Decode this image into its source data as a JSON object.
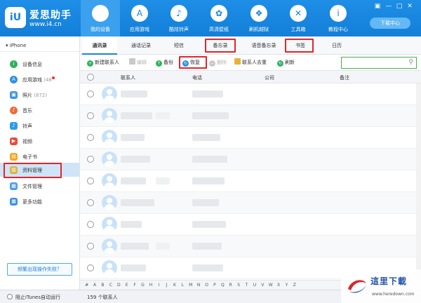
{
  "app": {
    "logo_badge": "iU",
    "name": "爱思助手",
    "url": "www.i4.cn"
  },
  "nav": [
    {
      "label": "我的设备",
      "icon": "apple-icon",
      "glyph": ""
    },
    {
      "label": "应用游戏",
      "icon": "app-store-icon",
      "glyph": "A"
    },
    {
      "label": "酷炫铃声",
      "icon": "bell-icon",
      "glyph": "♪"
    },
    {
      "label": "高清壁纸",
      "icon": "flower-icon",
      "glyph": "✿"
    },
    {
      "label": "刷机越狱",
      "icon": "dropbox-icon",
      "glyph": "❖"
    },
    {
      "label": "工具箱",
      "icon": "tools-icon",
      "glyph": "✕"
    },
    {
      "label": "教程中心",
      "icon": "info-icon",
      "glyph": "i"
    }
  ],
  "window": {
    "download_label": "下载中心",
    "icon_glyph": "▣",
    "min_glyph": "—",
    "max_glyph": "□",
    "close_glyph": "✕"
  },
  "sidebar": {
    "device": "iPhone",
    "device_arrow": "▾",
    "items": [
      {
        "label": "设备信息",
        "count": "",
        "icon": "info-icon",
        "color": "#2fb35c",
        "glyph": "i"
      },
      {
        "label": "应用游戏",
        "count": "(48",
        "icon": "app-store-icon",
        "color": "#2f8fe3",
        "glyph": "A"
      },
      {
        "label": "照片",
        "count": "(872)",
        "icon": "photo-icon",
        "color": "#3a93e8",
        "glyph": "▣"
      },
      {
        "label": "音乐",
        "count": "",
        "icon": "music-icon",
        "color": "#f06a3b",
        "glyph": "♪"
      },
      {
        "label": "铃声",
        "count": "",
        "icon": "bell-icon",
        "color": "#2f9ae8",
        "glyph": "♪"
      },
      {
        "label": "视频",
        "count": "",
        "icon": "video-icon",
        "color": "#e84c3d",
        "glyph": "▶"
      },
      {
        "label": "电子书",
        "count": "",
        "icon": "book-icon",
        "color": "#f5a623",
        "glyph": "▤"
      },
      {
        "label": "资料管理",
        "count": "",
        "icon": "folder-icon",
        "color": "#d9b34a",
        "glyph": "▥"
      },
      {
        "label": "文件管理",
        "count": "",
        "icon": "file-icon",
        "color": "#4a9ee8",
        "glyph": "▦"
      },
      {
        "label": "更多功能",
        "count": "",
        "icon": "grid-icon",
        "color": "#3b8fe0",
        "glyph": "▦"
      }
    ],
    "feedback": "频繁出现操作失败？"
  },
  "tabs": [
    "通讯录",
    "通话记录",
    "短信",
    "备忘录",
    "语音备忘录",
    "书签",
    "日历"
  ],
  "toolbar": {
    "new_contact": "新建联系人",
    "edit": "编辑",
    "backup": "备份",
    "restore": "恢复",
    "delete": "删除",
    "dedupe": "联系人去重",
    "refresh": "刷新",
    "new_glyph": "+",
    "backup_glyph": "↑",
    "restore_glyph": "↻",
    "delete_glyph": "−",
    "refresh_glyph": "↻",
    "search_glyph": "⚲"
  },
  "table": {
    "columns": [
      "联系人",
      "电话",
      "公司",
      "备注"
    ],
    "rows": 9
  },
  "alphabet": [
    "#",
    "A",
    "B",
    "C",
    "D",
    "E",
    "F",
    "G",
    "H",
    "I",
    "J",
    "K",
    "L",
    "M",
    "N",
    "O",
    "P",
    "Q",
    "R",
    "S",
    "T",
    "U",
    "V",
    "W",
    "X",
    "Y",
    "Z"
  ],
  "status": {
    "itunes": "阻止iTunes自动运行",
    "count": "159 个联系人"
  },
  "watermark": {
    "title": "這里下載",
    "url": "www.heredown.com"
  },
  "colors": {
    "accent": "#1883de",
    "highlight": "#e0262b",
    "search_border": "#49b04b"
  }
}
